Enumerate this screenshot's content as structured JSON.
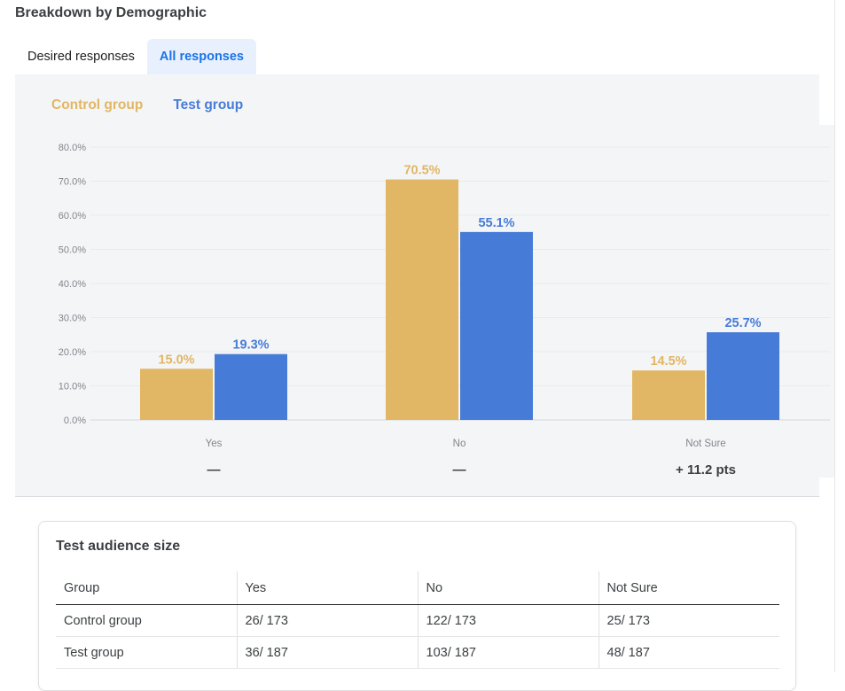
{
  "header": {
    "title": "Breakdown by Demographic"
  },
  "tabs": [
    {
      "label": "Desired responses",
      "active": false
    },
    {
      "label": "All responses",
      "active": true
    }
  ],
  "colors": {
    "control": "#e1b664",
    "test": "#467cd8"
  },
  "legend": {
    "control": "Control group",
    "test": "Test group"
  },
  "chart_data": {
    "type": "bar",
    "categories": [
      "Yes",
      "No",
      "Not Sure"
    ],
    "series": [
      {
        "name": "Control group",
        "values": [
          15.0,
          70.5,
          14.5
        ],
        "labels": [
          "15.0%",
          "70.5%",
          "14.5%"
        ]
      },
      {
        "name": "Test group",
        "values": [
          19.3,
          55.1,
          25.7
        ],
        "labels": [
          "19.3%",
          "55.1%",
          "25.7%"
        ]
      }
    ],
    "yticks": [
      "0.0%",
      "10.0%",
      "20.0%",
      "30.0%",
      "40.0%",
      "50.0%",
      "60.0%",
      "70.0%",
      "80.0%"
    ],
    "ylim": [
      0,
      80
    ],
    "grid": true,
    "legend_position": "top-left",
    "deltas": [
      "—",
      "—",
      "+ 11.2 pts"
    ]
  },
  "audience": {
    "title": "Test audience size",
    "columns": [
      "Group",
      "Yes",
      "No",
      "Not Sure"
    ],
    "rows": [
      [
        "Control group",
        "26/ 173",
        "122/ 173",
        "25/ 173"
      ],
      [
        "Test group",
        "36/ 187",
        "103/ 187",
        "48/ 187"
      ]
    ]
  }
}
